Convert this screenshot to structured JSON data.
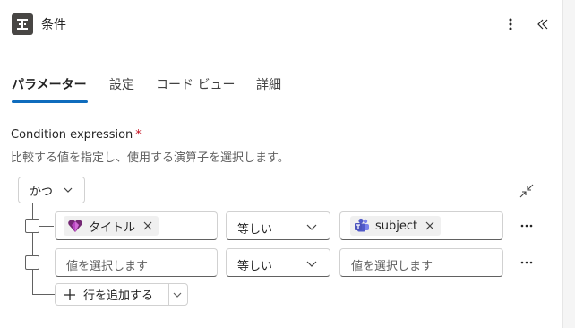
{
  "header": {
    "title": "条件",
    "icon": "condition-icon",
    "more_icon": "more-vertical-icon",
    "collapse_icon": "double-chevron-left-icon"
  },
  "tabs": [
    {
      "label": "パラメーター",
      "active": true
    },
    {
      "label": "設定",
      "active": false
    },
    {
      "label": "コード ビュー",
      "active": false
    },
    {
      "label": "詳細",
      "active": false
    }
  ],
  "condition": {
    "label": "Condition expression",
    "required_mark": "*",
    "description": "比較する値を指定し、使用する演算子を選択します。",
    "group_operator": "かつ",
    "rows": [
      {
        "left": {
          "token": "タイトル",
          "token_icon": "power-apps-icon"
        },
        "operator": "等しい",
        "right": {
          "token": "subject",
          "token_icon": "teams-icon"
        }
      },
      {
        "left": {
          "placeholder": "値を選択します"
        },
        "operator": "等しい",
        "right": {
          "placeholder": "値を選択します"
        }
      }
    ],
    "add_row_label": "行を追加する"
  },
  "colors": {
    "accent": "#0f6cbd",
    "required": "#c50f1f"
  }
}
